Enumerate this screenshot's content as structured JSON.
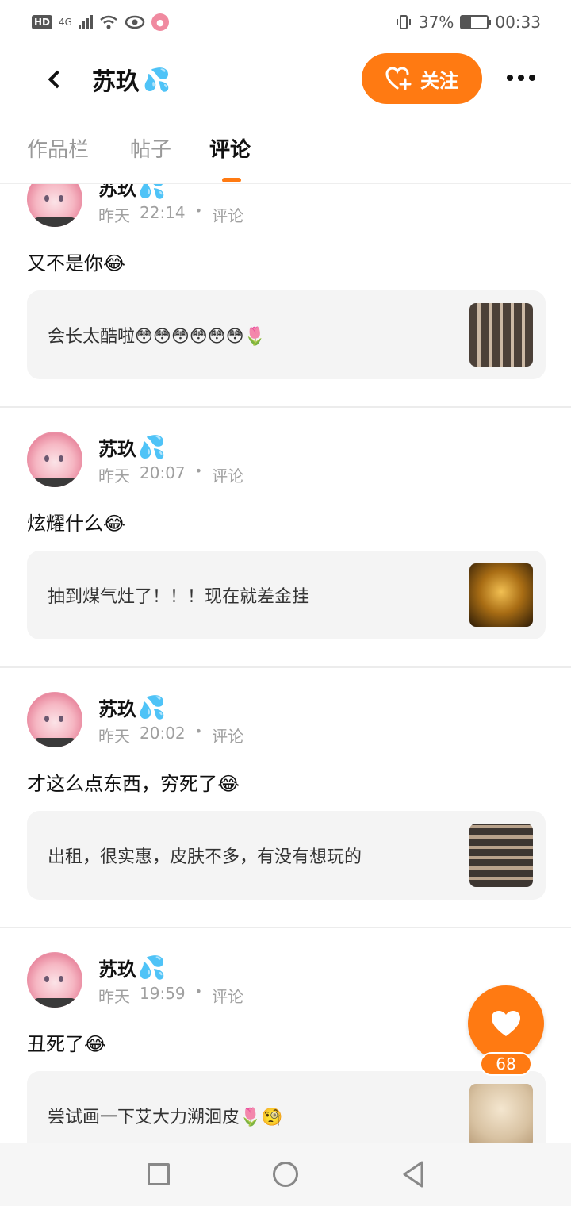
{
  "status_bar": {
    "hd": "HD",
    "network": "4G",
    "battery_percent_text": "37%",
    "battery_level": 0.37,
    "time": "00:33"
  },
  "header": {
    "title": "苏玖",
    "follow_label": "关注"
  },
  "tabs": [
    {
      "label": "作品栏",
      "active": false
    },
    {
      "label": "帖子",
      "active": false
    },
    {
      "label": "评论",
      "active": true
    }
  ],
  "posts": [
    {
      "author": "苏玖",
      "date": "昨天",
      "time": "22:14",
      "type": "评论",
      "text": "又不是你😂",
      "quote": "会长太酷啦😳😳😳😳😳😳🌷"
    },
    {
      "author": "苏玖",
      "date": "昨天",
      "time": "20:07",
      "type": "评论",
      "text": "炫耀什么😂",
      "quote": "抽到煤气灶了！！！现在就差金挂"
    },
    {
      "author": "苏玖",
      "date": "昨天",
      "time": "20:02",
      "type": "评论",
      "text": "才这么点东西，穷死了😂",
      "quote": "出租，很实惠，皮肤不多，有没有想玩的"
    },
    {
      "author": "苏玖",
      "date": "昨天",
      "time": "19:59",
      "type": "评论",
      "text": "丑死了😂",
      "quote": "尝试画一下艾大力溯洄皮🌷🧐"
    }
  ],
  "like": {
    "count": "68"
  },
  "colors": {
    "accent": "#ff7a12",
    "card_bg": "#f4f4f4",
    "meta_text": "#a0a0a0"
  }
}
